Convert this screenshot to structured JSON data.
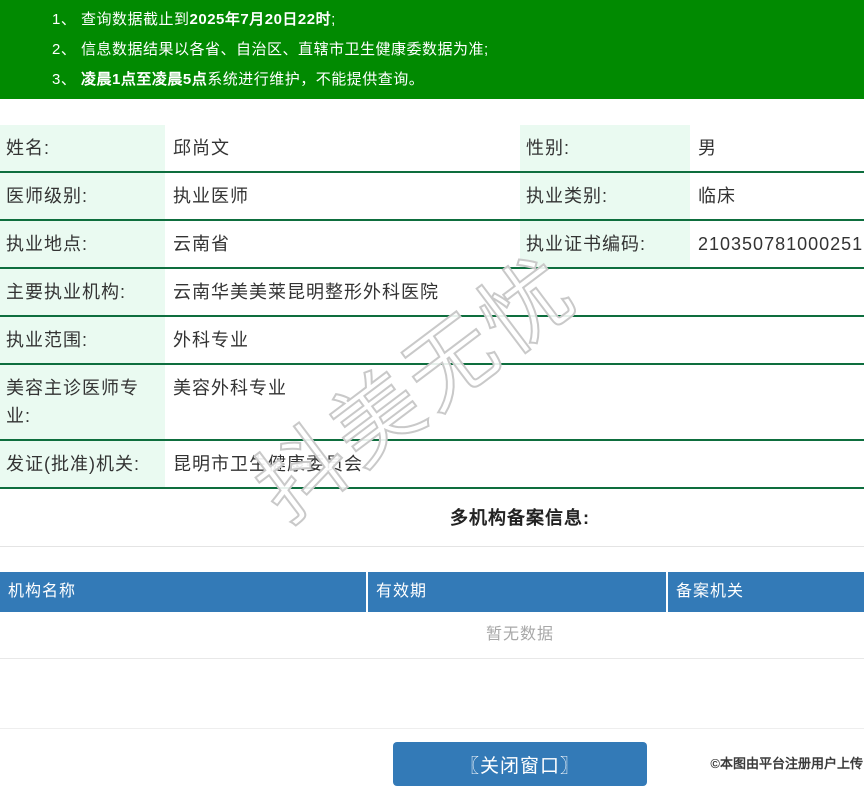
{
  "banner": {
    "lines": [
      {
        "pre": "1、 查询数据截止到",
        "bold": "2025年7月20日22时",
        "post": ";"
      },
      {
        "pre": "2、 信息数据结果以各省、自治区、直辖市卫生健康委数据为准;",
        "bold": "",
        "post": ""
      },
      {
        "pre": "3、 ",
        "bold": "凌晨1点至凌晨5点",
        "post": "系统进行维护，不能提供查询。"
      }
    ]
  },
  "doctor_info": {
    "rows": [
      {
        "cells": [
          {
            "label": "姓名:",
            "value": "邱尚文"
          },
          {
            "label": "性别:",
            "value": "男"
          }
        ]
      },
      {
        "cells": [
          {
            "label": "医师级别:",
            "value": "执业医师"
          },
          {
            "label": "执业类别:",
            "value": "临床"
          }
        ]
      },
      {
        "cells": [
          {
            "label": "执业地点:",
            "value": "云南省"
          },
          {
            "label": "执业证书编码:",
            "value": "210350781000251"
          }
        ]
      },
      {
        "cells": [
          {
            "label": "主要执业机构:",
            "value": "云南华美美莱昆明整形外科医院"
          }
        ]
      },
      {
        "cells": [
          {
            "label": "执业范围:",
            "value": "外科专业"
          }
        ]
      },
      {
        "cells": [
          {
            "label": "美容主诊医师专业:",
            "value": "美容外科专业"
          }
        ]
      },
      {
        "cells": [
          {
            "label": "发证(批准)机关:",
            "value": "昆明市卫生健康委员会"
          }
        ]
      }
    ]
  },
  "filing_section": {
    "title": "多机构备案信息:",
    "columns": [
      "机构名称",
      "有效期",
      "备案机关"
    ],
    "empty_text": "暂无数据"
  },
  "footer": {
    "close_button": "〖关闭窗口〗",
    "upload_note": "©本图由平台注册用户上传"
  },
  "watermark": "抖美无忧",
  "colors": {
    "banner_green": "#018a01",
    "row_border_green": "#0e6e3e",
    "label_mint": "#eafaf1",
    "header_blue": "#337ab7",
    "button_blue": "#337ab7"
  }
}
